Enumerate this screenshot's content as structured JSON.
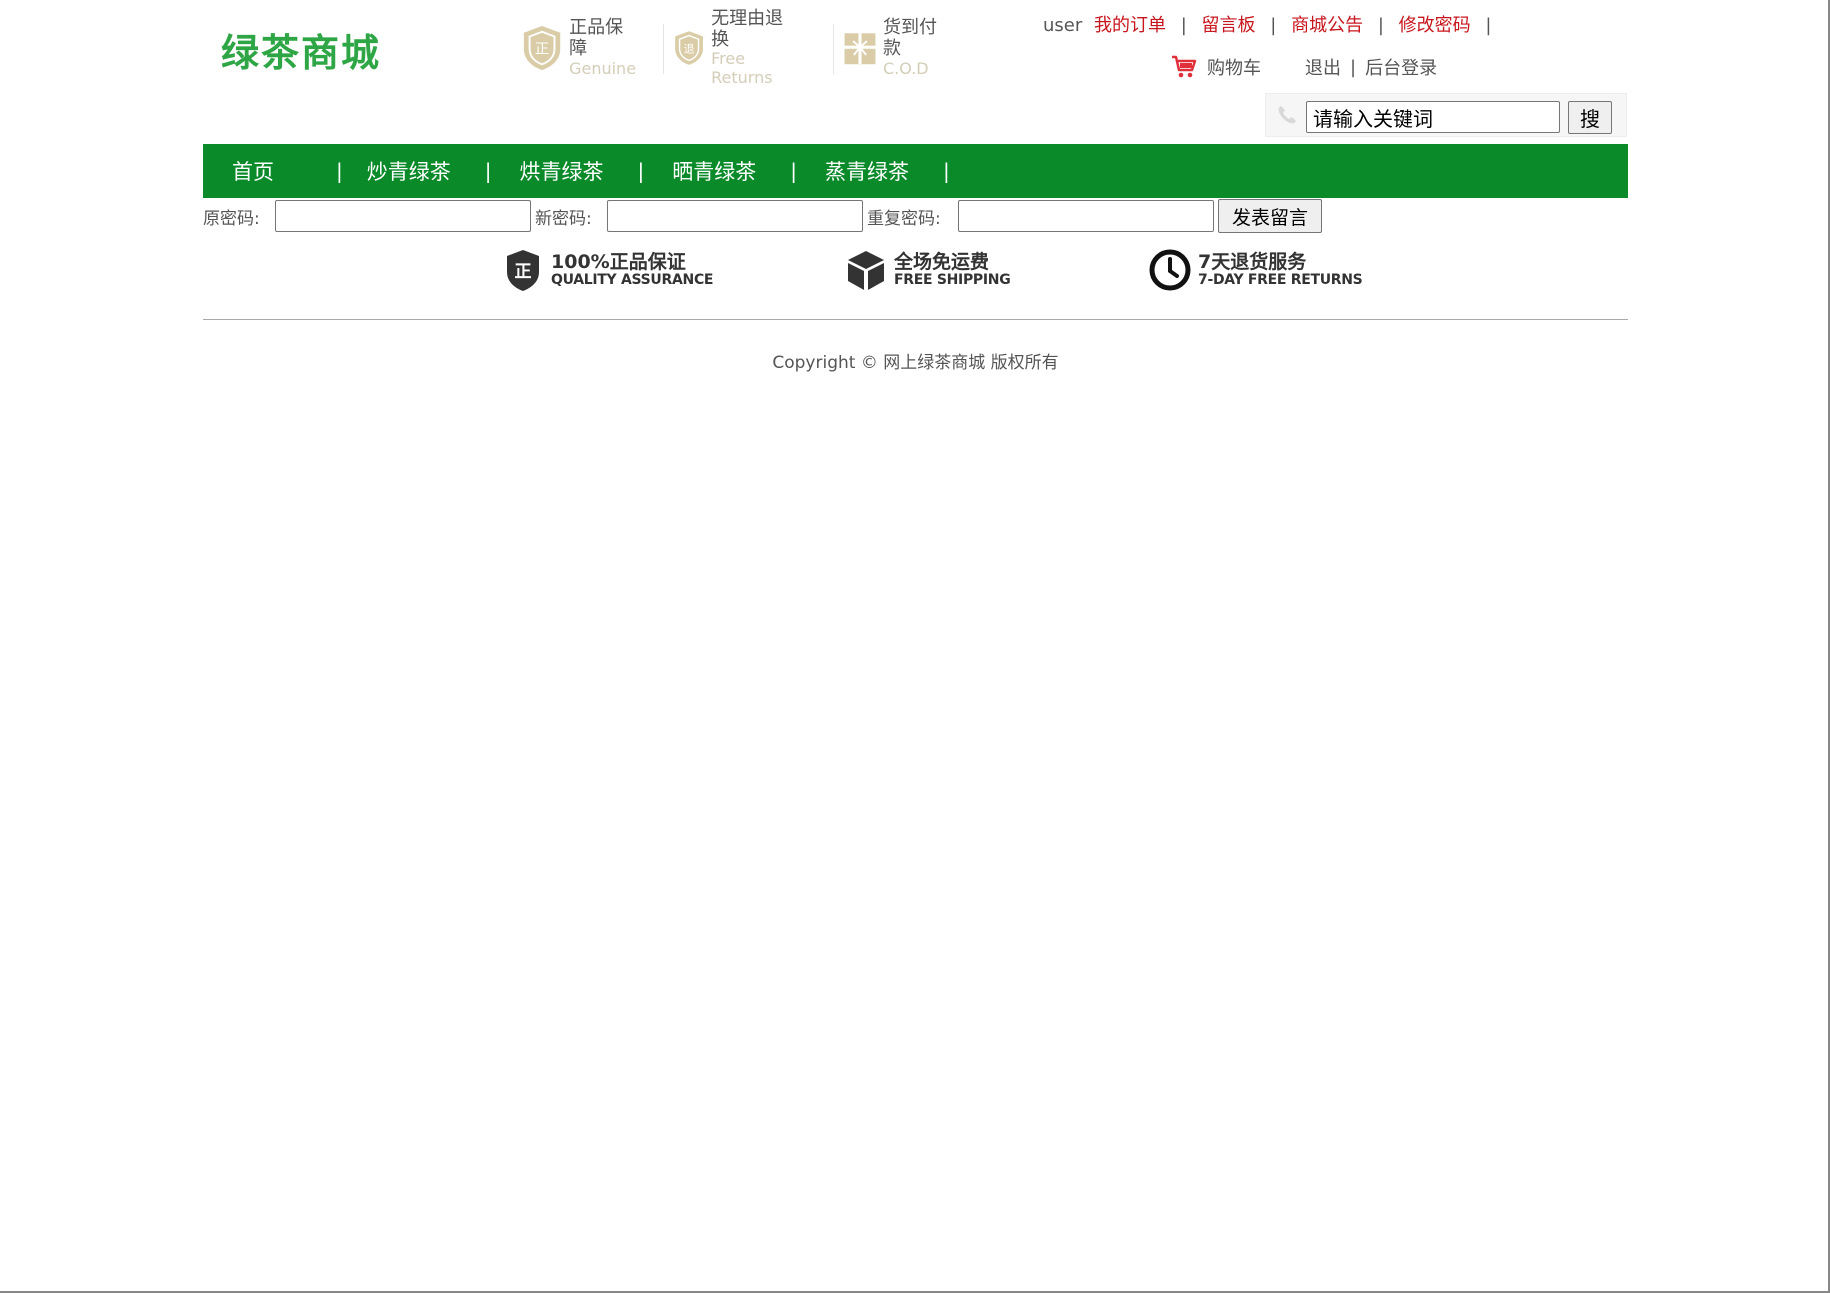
{
  "logo": {
    "text": "绿茶商城"
  },
  "guarantees": [
    {
      "icon": "genuine-badge-icon",
      "glyph": "正",
      "cn": "正品保障",
      "en": "Genuine"
    },
    {
      "icon": "free-returns-badge-icon",
      "glyph": "退",
      "cn": "无理由退换",
      "en": "Free Returns"
    },
    {
      "icon": "cod-gift-icon",
      "cn": "货到付款",
      "en": "C.O.D"
    }
  ],
  "user_links": {
    "username": "user",
    "my_orders": "我的订单",
    "message_board": "留言板",
    "announcements": "商城公告",
    "change_password": "修改密码",
    "separator": "|"
  },
  "cart": {
    "label": "购物车",
    "logout": "退出",
    "admin_login": "后台登录"
  },
  "search": {
    "value": "请输入关键词",
    "button": "搜"
  },
  "nav": {
    "items": [
      "首页",
      "炒青绿茶",
      "烘青绿茶",
      "晒青绿茶",
      "蒸青绿茶"
    ],
    "separator": "|"
  },
  "password_form": {
    "old_label": "原密码:",
    "new_label": "新密码:",
    "repeat_label": "重复密码:",
    "submit": "发表留言"
  },
  "services": [
    {
      "icon": "quality-shield-icon",
      "glyph": "正",
      "cn": "100%正品保证",
      "en": "QUALITY ASSURANCE"
    },
    {
      "icon": "box-icon",
      "cn": "全场免运费",
      "en": "FREE SHIPPING"
    },
    {
      "icon": "clock-icon",
      "cn": "7天退货服务",
      "en": "7-DAY FREE RETURNS"
    }
  ],
  "footer": {
    "copyright": "Copyright © 网上绿茶商城 版权所有"
  },
  "colors": {
    "brand_green": "#0b8a2a",
    "logo_green": "#2fa645",
    "link_red": "#c8161d",
    "badge_beige": "#d9cca6"
  }
}
